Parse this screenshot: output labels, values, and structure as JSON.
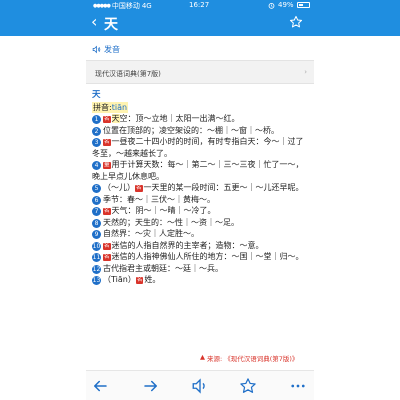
{
  "status": {
    "carrier": "中国移动",
    "network": "4G",
    "time": "16:27",
    "battery_text": "49%",
    "battery_level": 0.49
  },
  "nav": {
    "back": "‹",
    "title": "天"
  },
  "pronounce": {
    "label": "发音"
  },
  "source": {
    "name": "现代汉语词典(第7版)",
    "arrow": "›"
  },
  "entry": {
    "headword": "天",
    "pinyin_label": "拼音:",
    "pinyin": "tiān",
    "definitions": [
      {
        "num": "1",
        "tag": "名",
        "hl": "天",
        "text": "空：顶～立地｜太阳一出满～红。"
      },
      {
        "num": "2",
        "tag": "",
        "hl": "",
        "text": "位置在顶部的；凌空架设的：～棚｜～窗｜～桥。"
      },
      {
        "num": "3",
        "tag": "名",
        "hl": "",
        "text": "一昼夜二十四小时的时间，有时专指白天：今～｜过了冬至，～越来越长了。"
      },
      {
        "num": "4",
        "tag": "量",
        "hl": "",
        "text": "用于计算天数：每～｜第二～｜三～三夜｜忙了一～，晚上早点儿休息吧。"
      },
      {
        "num": "5",
        "tag": "名",
        "hl": "",
        "prefix": "（～儿）",
        "text": "一天里的某一段时间：五更～｜～儿还早呢。"
      },
      {
        "num": "6",
        "tag": "",
        "hl": "",
        "text": "季节：春～｜三伏～｜黄梅～。"
      },
      {
        "num": "7",
        "tag": "名",
        "hl": "",
        "text": "天气：阴～｜～晴｜～冷了。"
      },
      {
        "num": "8",
        "tag": "",
        "hl": "",
        "text": "天然的；天生的：～性｜～资｜～足。"
      },
      {
        "num": "9",
        "tag": "",
        "hl": "",
        "text": "自然界：～灾｜人定胜～。"
      },
      {
        "num": "10",
        "tag": "名",
        "hl": "",
        "text": "迷信的人指自然界的主宰者；造物：～意。"
      },
      {
        "num": "11",
        "tag": "名",
        "hl": "",
        "text": "迷信的人指神佛仙人所住的地方：～国｜～堂｜归～。"
      },
      {
        "num": "12",
        "tag": "",
        "hl": "",
        "text": "古代指君主或朝廷：～廷｜～兵。"
      },
      {
        "num": "13",
        "tag": "名",
        "hl": "",
        "prefix": "（Tiān）",
        "text": "姓。"
      }
    ]
  },
  "footer": {
    "marker": "▲",
    "label": "来源:",
    "source": "《现代汉语词典(第7版)》"
  },
  "colors": {
    "brand": "#1f8ee0",
    "accent": "#1f6fc8",
    "tag": "#d9342b",
    "highlight": "#fff3b0"
  },
  "icons": {
    "back": "arrow-left-icon",
    "forward": "arrow-right-icon",
    "audio": "speaker-icon",
    "favorite": "star-icon",
    "more": "more-icon"
  }
}
